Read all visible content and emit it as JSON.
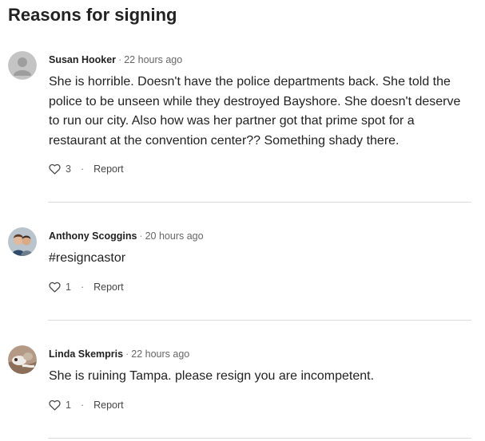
{
  "page": {
    "title": "Reasons for signing"
  },
  "comments": [
    {
      "author": "Susan Hooker",
      "separator": "·",
      "time": "22 hours ago",
      "text": "She is horrible. Doesn't have the police departments back. She told the police to be unseen while they destroyed Bayshore. She doesn't deserve to run our city. Also how was her partner got that prime spot for a restaurant at the convention center?? Something shady there.",
      "likes": "3",
      "dot": "·",
      "report_label": "Report",
      "avatar": "default-user-icon"
    },
    {
      "author": "Anthony Scoggins",
      "separator": "·",
      "time": "20 hours ago",
      "text": "#resigncastor",
      "likes": "1",
      "dot": "·",
      "report_label": "Report",
      "avatar": "user-photo"
    },
    {
      "author": "Linda Skempris",
      "separator": "·",
      "time": "22 hours ago",
      "text": "She is ruining Tampa. please resign you are incompetent.",
      "likes": "1",
      "dot": "·",
      "report_label": "Report",
      "avatar": "user-photo"
    }
  ],
  "colors": {
    "text": "#222222",
    "muted": "#666666",
    "divider": "#dcdcdc",
    "avatar_placeholder": "#c4c4c4"
  }
}
